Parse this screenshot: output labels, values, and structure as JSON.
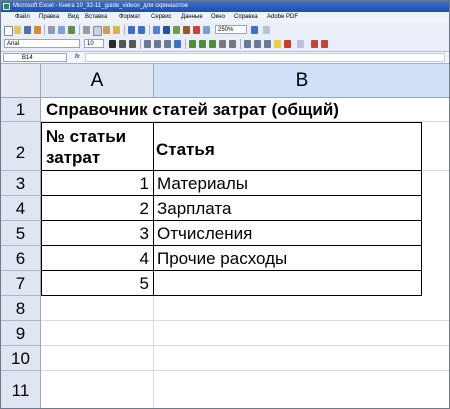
{
  "window": {
    "title": "Microsoft Excel - Книга 10_32-11_guide_videos_для скриншотов"
  },
  "menu": [
    "Файл",
    "Правка",
    "Вид",
    "Вставка",
    "Формат",
    "Сервис",
    "Данные",
    "Окно",
    "Справка",
    "Adobe PDF"
  ],
  "toolbar": {
    "zoom": "250%",
    "font_name": "Arial",
    "font_size": "10"
  },
  "formula_bar": {
    "name_box": "B14",
    "fx_label": "fx",
    "formula": ""
  },
  "sheet": {
    "columns": [
      "A",
      "B"
    ],
    "rows": [
      "1",
      "2",
      "3",
      "4",
      "5",
      "6",
      "7",
      "8",
      "9",
      "10",
      "11"
    ],
    "title": "Справочник статей затрат (общий)",
    "header": {
      "col_a_line1": "№ статьи",
      "col_a_line2": "затрат",
      "col_b": "Статья"
    },
    "data": [
      {
        "num": "1",
        "name": "Материалы"
      },
      {
        "num": "2",
        "name": "Зарплата"
      },
      {
        "num": "3",
        "name": "Отчисления"
      },
      {
        "num": "4",
        "name": "Прочие расходы"
      },
      {
        "num": "5",
        "name": ""
      }
    ]
  }
}
